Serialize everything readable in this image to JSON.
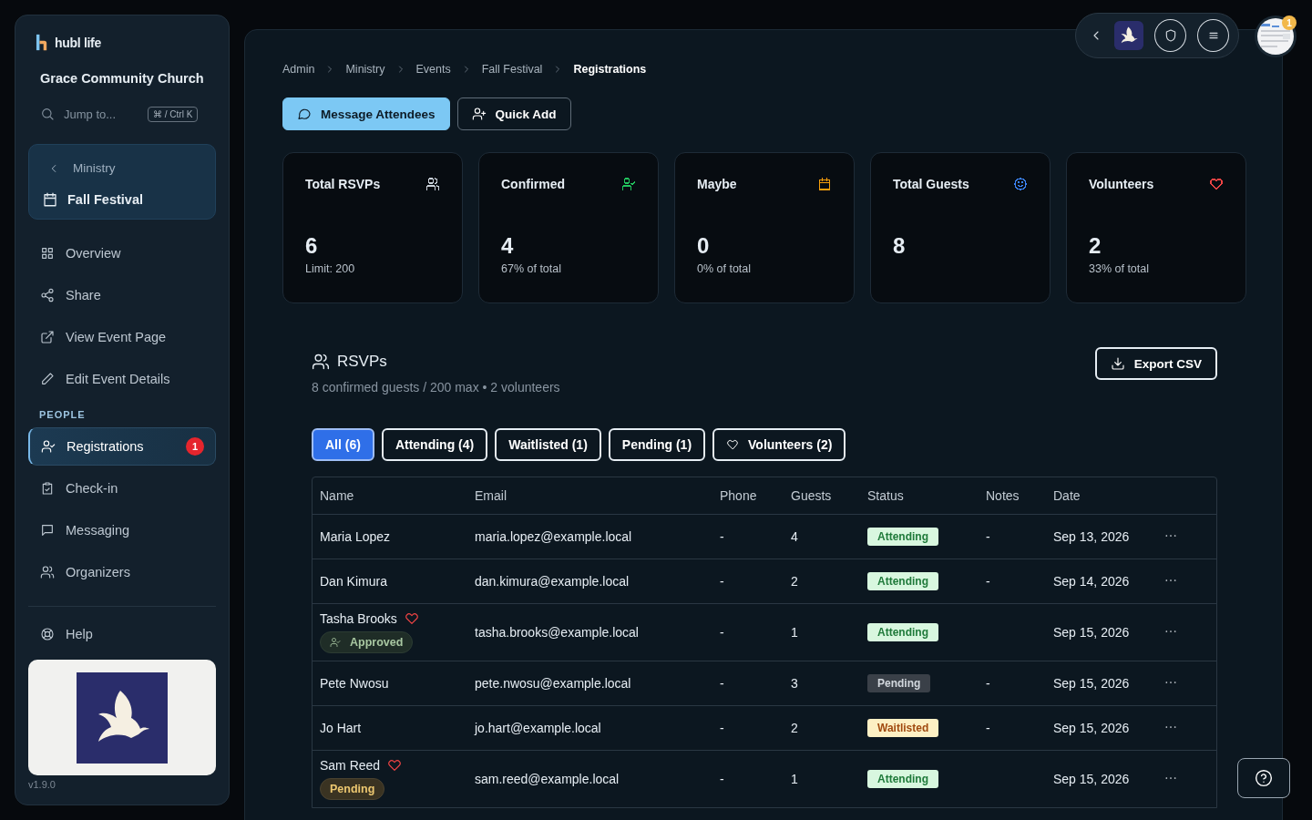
{
  "sidebar": {
    "brand": "hubl life",
    "org": "Grace Community Church",
    "search": {
      "placeholder": "Jump to...",
      "shortcut": "⌘ / Ctrl K"
    },
    "context": {
      "back": "Ministry",
      "title": "Fall Festival"
    },
    "nav": [
      {
        "label": "Overview",
        "selected": false
      },
      {
        "label": "Share",
        "selected": false
      },
      {
        "label": "View Event Page",
        "selected": false
      },
      {
        "label": "Edit Event Details",
        "selected": false
      }
    ],
    "section_label": "PEOPLE",
    "people": [
      {
        "label": "Registrations",
        "selected": true,
        "badge": "1"
      },
      {
        "label": "Check-in",
        "selected": false
      },
      {
        "label": "Messaging",
        "selected": false
      },
      {
        "label": "Organizers",
        "selected": false
      }
    ],
    "help": "Help",
    "version": "v1.9.0"
  },
  "topbar": {
    "avatar_badge": "1"
  },
  "breadcrumb": [
    "Admin",
    "Ministry",
    "Events",
    "Fall Festival",
    "Registrations"
  ],
  "actions": [
    {
      "label": "Message Attendees",
      "kind": "primary"
    },
    {
      "label": "Quick Add",
      "kind": "outline"
    }
  ],
  "stats": [
    {
      "title": "Total RSVPs",
      "value": "6",
      "note": "Limit: 200",
      "color": "#c9d1d9"
    },
    {
      "title": "Confirmed",
      "value": "4",
      "note": "67% of total",
      "color": "#22c55e"
    },
    {
      "title": "Maybe",
      "value": "0",
      "note": "0% of total",
      "color": "#f59e0b"
    },
    {
      "title": "Total Guests",
      "value": "8",
      "color": "#3b82f6"
    },
    {
      "title": "Volunteers",
      "value": "2",
      "note": "33% of total",
      "color": "#ef4444"
    }
  ],
  "rsvps": {
    "title": "RSVPs",
    "subtitle": "8 confirmed guests / 200 max • 2 volunteers",
    "export": "Export CSV",
    "filters": [
      {
        "label": "All (6)",
        "selected": true
      },
      {
        "label": "Attending (4)",
        "selected": false
      },
      {
        "label": "Waitlisted (1)",
        "selected": false
      },
      {
        "label": "Pending (1)",
        "selected": false
      },
      {
        "label": "Volunteers (2)",
        "selected": false,
        "kind": "volunteers"
      }
    ],
    "columns": [
      "Name",
      "Email",
      "Phone",
      "Guests",
      "Status",
      "Notes",
      "Date"
    ],
    "rows": [
      {
        "name": "Maria Lopez",
        "volunteer": false,
        "email": "maria.lopez@example.local",
        "phone": "-",
        "guests": "4",
        "status": {
          "label": "Attending",
          "kind": "attending"
        },
        "notes": "-",
        "date": "Sep 13, 2026"
      },
      {
        "name": "Dan Kimura",
        "volunteer": false,
        "email": "dan.kimura@example.local",
        "phone": "-",
        "guests": "2",
        "status": {
          "label": "Attending",
          "kind": "attending"
        },
        "notes": "-",
        "date": "Sep 14, 2026"
      },
      {
        "name": "Tasha Brooks",
        "volunteer": true,
        "tag": {
          "label": "Approved",
          "kind": "approved"
        },
        "email": "tasha.brooks@example.local",
        "phone": "-",
        "guests": "1",
        "status": {
          "label": "Attending",
          "kind": "attending"
        },
        "date": "Sep 15, 2026"
      },
      {
        "name": "Pete Nwosu",
        "volunteer": false,
        "email": "pete.nwosu@example.local",
        "phone": "-",
        "guests": "3",
        "status": {
          "label": "Pending",
          "kind": "pending"
        },
        "notes": "-",
        "date": "Sep 15, 2026"
      },
      {
        "name": "Jo Hart",
        "volunteer": false,
        "email": "jo.hart@example.local",
        "phone": "-",
        "guests": "2",
        "status": {
          "label": "Waitlisted",
          "kind": "waitlisted"
        },
        "notes": "-",
        "date": "Sep 15, 2026"
      },
      {
        "name": "Sam Reed",
        "volunteer": true,
        "tag": {
          "label": "Pending",
          "kind": "pending"
        },
        "email": "sam.reed@example.local",
        "phone": "-",
        "guests": "1",
        "status": {
          "label": "Attending",
          "kind": "attending"
        },
        "date": "Sep 15, 2026"
      }
    ]
  }
}
